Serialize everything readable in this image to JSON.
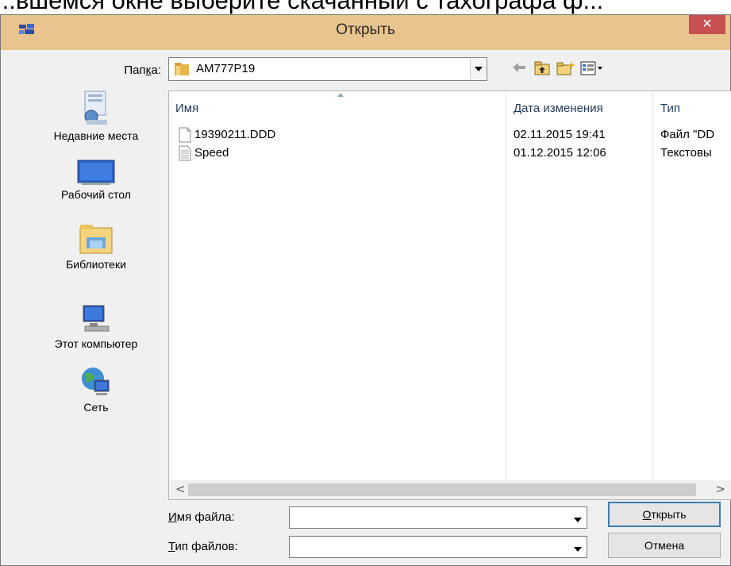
{
  "caption": {
    "text": "...вшемся окне выберите скачанный с тахографа ф..."
  },
  "dialog": {
    "title": "Открыть",
    "close_glyph": "✕",
    "accent_color": "#e8c48e"
  },
  "folder": {
    "label_pre": "Пап",
    "label_key": "к",
    "label_post": "а:",
    "value": "AM777P19"
  },
  "places": [
    {
      "label": "Недавние места",
      "icon": "recent-places-icon"
    },
    {
      "label": "Рабочий стол",
      "icon": "desktop-icon"
    },
    {
      "label": "Библиотеки",
      "icon": "libraries-icon"
    },
    {
      "label": "Этот компьютер",
      "icon": "computer-icon"
    },
    {
      "label": "Сеть",
      "icon": "network-icon"
    }
  ],
  "columns": {
    "name": "Имя",
    "date": "Дата изменения",
    "type": "Тип"
  },
  "files": [
    {
      "name": "19390211.DDD",
      "date": "02.11.2015 19:41",
      "type": "Файл \"DD",
      "icon": "blank-file-icon"
    },
    {
      "name": "Speed",
      "date": "01.12.2015 12:06",
      "type": "Текстовы",
      "icon": "text-file-icon"
    }
  ],
  "scroll": {
    "left": "<",
    "right": ">"
  },
  "filename": {
    "label_key": "И",
    "label_rest": "мя файла:",
    "value": ""
  },
  "filetype": {
    "label_key": "Т",
    "label_rest": "ип файлов:",
    "value": ""
  },
  "buttons": {
    "open_key": "О",
    "open_rest": "ткрыть",
    "cancel": "Отмена"
  }
}
